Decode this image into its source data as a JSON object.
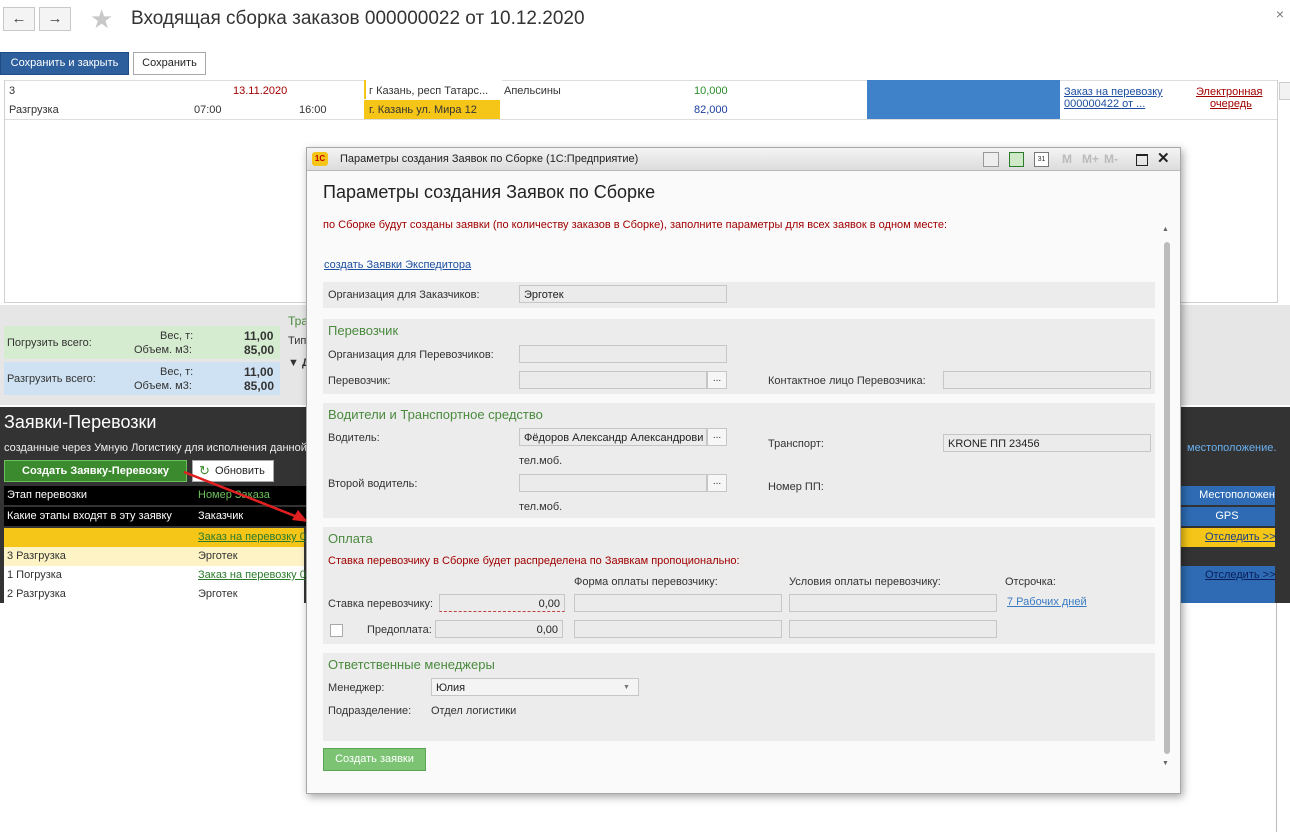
{
  "header": {
    "title": "Входящая сборка заказов 000000022 от 10.12.2020",
    "back_icon": "←",
    "forward_icon": "→",
    "close_icon": "×"
  },
  "toolbar": {
    "save_close": "Сохранить и закрыть",
    "save": "Сохранить"
  },
  "top_grid": {
    "r1_num": "3",
    "r1_date": "13.11.2020",
    "r1_addr": "г Казань, респ Татарс...",
    "r1_cargo": "Апельсины",
    "r1_qty": "10,000",
    "r2_type": "Разгрузка",
    "r2_t1": "07:00",
    "r2_t2": "16:00",
    "r2_addr": "г. Казань ул. Мира 12",
    "r2_qty": "82,000",
    "order_link_1": "Заказ на перевозку",
    "order_link_2": "000000422 от ...",
    "queue_link_1": "Электронная",
    "queue_link_2": "очередь"
  },
  "summary": {
    "load_label": "Погрузить всего:",
    "unload_label": "Разгрузить всего:",
    "weight_label": "Вес, т:",
    "volume_label": "Объем. м3:",
    "load_weight": "11,00",
    "load_volume": "85,00",
    "unload_weight": "11,00",
    "unload_volume": "85,00",
    "frag1": "Тра",
    "frag2": "Тип",
    "frag3": "▼ Д"
  },
  "requests": {
    "title": "Заявки-Перевозки",
    "subtitle": "созданные через Умную Логистику для исполнения данной",
    "right_link": "местоположение.",
    "create_btn": "Создать Заявку-Перевозку",
    "refresh_btn": "Обновить",
    "col_stage": "Этап перевозки",
    "col_order": "Номер Заказа",
    "col_stages_inc": "Какие этапы входят в эту заявку",
    "col_customer": "Заказчик",
    "col_location": "Местоположен",
    "col_gps": "GPS",
    "row1_order": "Заказ на перевозку 0",
    "row2_stage": "3 Разгрузка",
    "row2_customer": "Эрготек",
    "row3_stage": "1 Погрузка",
    "row3_order": "Заказ на перевозку 0",
    "row4_stage": "2 Разгрузка",
    "row4_customer": "Эрготек",
    "track1": "Отследить >>",
    "track2": "Отследить >>"
  },
  "dialog": {
    "window_title": "Параметры создания Заявок по Сборке  (1С:Предприятие)",
    "heading": "Параметры создания Заявок по Сборке",
    "notice": "по Сборке будут созданы заявки (по количеству заказов в Сборке), заполните параметры для всех заявок в одном месте:",
    "expeditor_link": "создать Заявки Экспедитора",
    "org_customers_label": "Организация для Заказчиков:",
    "org_customers_value": "Эрготек",
    "carrier_section": "Перевозчик",
    "org_carriers_label": "Организация для Перевозчиков:",
    "carrier_label": "Перевозчик:",
    "carrier_contact_label": "Контактное лицо Перевозчика:",
    "drivers_section": "Водители и Транспортное средство",
    "driver_label": "Водитель:",
    "driver_value": "Фёдоров Александр Александрови",
    "phone_label": "тел.моб.",
    "transport_label": "Транспорт:",
    "transport_value": "KRONE  ПП 23456",
    "second_driver_label": "Второй водитель:",
    "trailer_number_label": "Номер ПП:",
    "phone_label2": "тел.моб.",
    "payment_section": "Оплата",
    "payment_note": "Ставка перевозчику в Сборке будет распределена по Заявкам пропоционально:",
    "pay_form_label": "Форма оплаты перевозчику:",
    "pay_terms_label": "Условия оплаты перевозчику:",
    "delay_label": "Отсрочка:",
    "rate_label": "Ставка перевозчику:",
    "rate_value": "0,00",
    "delay_value": "7 Рабочих дней",
    "prepay_label": "Предоплата:",
    "prepay_value": "0,00",
    "managers_section": "Ответственные менеджеры",
    "manager_label": "Менеджер:",
    "manager_value": "Юлия",
    "department_label": "Подразделение:",
    "department_value": "Отдел логистики",
    "create_btn": "Создать заявки",
    "dots": "..."
  },
  "colors": {
    "accent_blue": "#2e5f9d",
    "green_button": "#3c8a2e",
    "section_green": "#4a8a3e",
    "notice_red": "#a00000",
    "dark_panel": "#333333",
    "highlight_yellow": "#f5c518"
  }
}
